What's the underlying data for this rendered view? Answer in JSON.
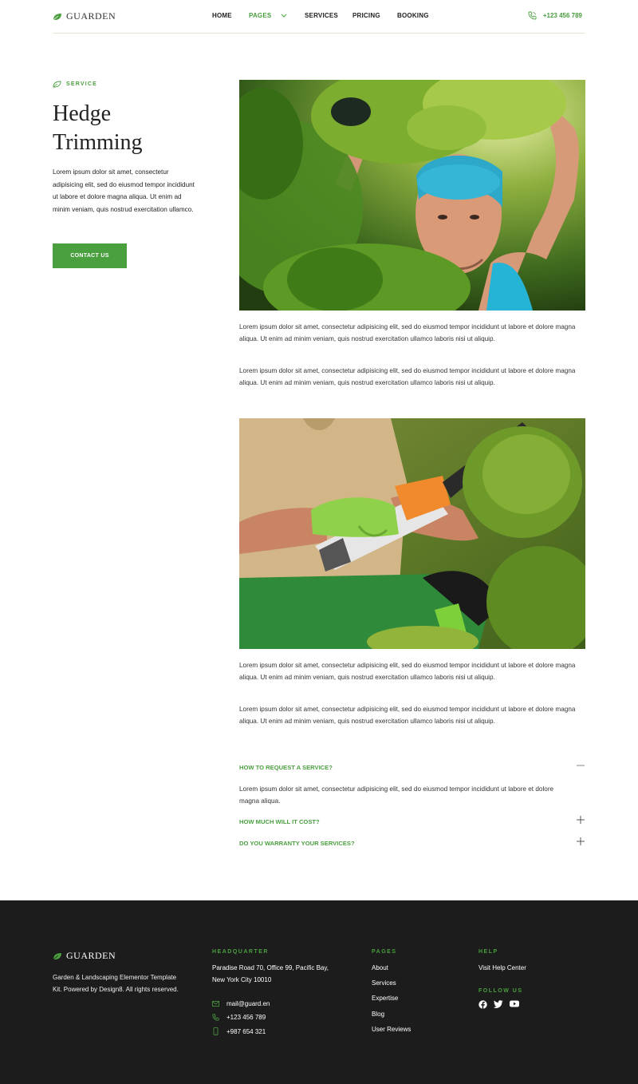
{
  "header": {
    "brand": "GUARDEN",
    "nav": [
      "HOME",
      "PAGES",
      "SERVICES",
      "PRICING",
      "BOOKING"
    ],
    "phone": "+123 456 789"
  },
  "intro": {
    "tag": "SERVICE",
    "title": "Hedge Trimming",
    "text": "Lorem ipsum dolor sit amet, consectetur adipisicing elit, sed do eiusmod tempor incididunt ut labore et dolore magna aliqua. Ut enim ad minim veniam, quis nostrud exercitation ullamco.",
    "button": "CONTACT US"
  },
  "content": {
    "paragraphs": [
      "Lorem ipsum dolor sit amet, consectetur adipisicing elit, sed do eiusmod tempor incididunt ut labore et dolore magna aliqua. Ut enim ad minim veniam, quis nostrud exercitation ullamco laboris nisi ut aliquip.",
      "Lorem ipsum dolor sit amet, consectetur adipisicing elit, sed do eiusmod tempor incididunt ut labore et dolore magna aliqua. Ut enim ad minim veniam, quis nostrud exercitation ullamco laboris nisi ut aliquip.",
      "Lorem ipsum dolor sit amet, consectetur adipisicing elit, sed do eiusmod tempor incididunt ut labore et dolore magna aliqua. Ut enim ad minim veniam, quis nostrud exercitation ullamco laboris nisi ut aliquip.",
      "Lorem ipsum dolor sit amet, consectetur adipisicing elit, sed do eiusmod tempor incididunt ut labore et dolore magna aliqua. Ut enim ad minim veniam, quis nostrud exercitation ullamco laboris nisi ut aliquip."
    ]
  },
  "faq": [
    {
      "question": "HOW TO REQUEST A SERVICE?",
      "answer": "Lorem ipsum dolor sit amet, consectetur adipisicing elit, sed do eiusmod tempor incididunt ut labore et dolore magna aliqua.",
      "expanded": true
    },
    {
      "question": "HOW MUCH WILL IT COST?",
      "expanded": false
    },
    {
      "question": "DO YOU WARRANTY YOUR SERVICES?",
      "expanded": false
    }
  ],
  "footer": {
    "brand": "GUARDEN",
    "description": "Garden & Landscaping Elementor Template Kit. Powered by Design8. All rights reserved.",
    "headquarter_title": "HEADQUARTER",
    "address": "Paradise Road 70, Office 99, Pacific Bay,  New York City 10010",
    "email": "mail@guard.en",
    "phone": "+123 456 789",
    "mobile": "+987 654 321",
    "pages_title": "PAGES",
    "pages": [
      "About",
      "Services",
      "Expertise",
      "Blog",
      "User Reviews"
    ],
    "help_title": "HELP",
    "help_link": "Visit Help Center",
    "follow_title": "FOLLOW US"
  },
  "colors": {
    "accent": "#4a9f3f",
    "footer_bg": "#1c1c1c"
  }
}
